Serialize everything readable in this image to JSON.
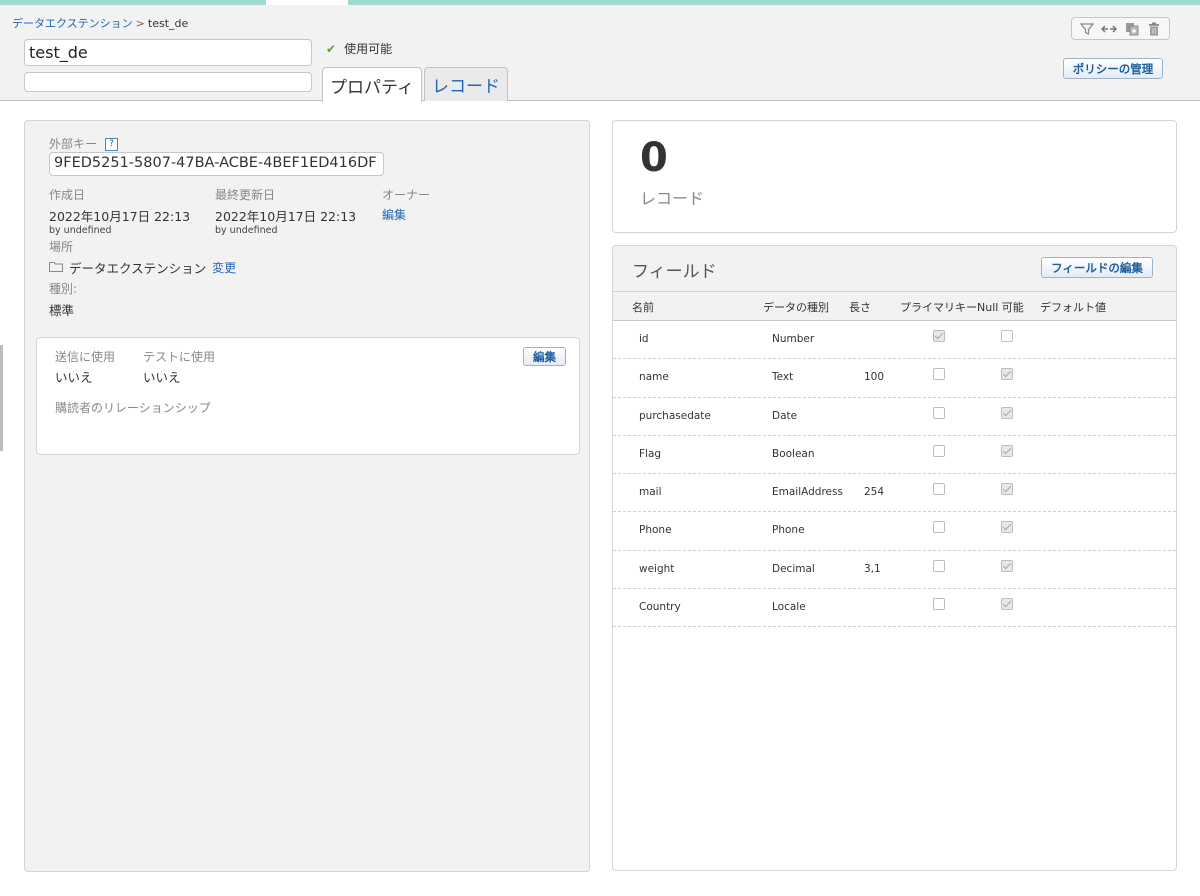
{
  "breadcrumb": {
    "parent": "データエクステンション",
    "separator": ">",
    "current": "test_de"
  },
  "header": {
    "name_value": "test_de",
    "description_value": "",
    "status_label": "使用可能",
    "tabs": [
      {
        "label": "プロパティ"
      },
      {
        "label": "レコード"
      }
    ],
    "policy_button": "ポリシーの管理",
    "toolbar_icons": [
      "filter-icon",
      "swap-icon",
      "copy-icon",
      "trash-icon"
    ]
  },
  "properties": {
    "external_key_label": "外部キー",
    "help_label": "?",
    "external_key_value": "9FED5251-5807-47BA-ACBE-4BEF1ED416DF",
    "created_label": "作成日",
    "created_value": "2022年10月17日 22:13",
    "created_by": "by undefined",
    "modified_label": "最終更新日",
    "modified_value": "2022年10月17日 22:13",
    "modified_by": "by undefined",
    "owner_label": "オーナー",
    "owner_edit": "編集",
    "location_label": "場所",
    "location_value": "データエクステンション",
    "location_change": "変更",
    "type_label": "種別:",
    "type_value": "標準"
  },
  "sendable": {
    "send_label": "送信に使用",
    "send_value": "いいえ",
    "test_label": "テストに使用",
    "test_value": "いいえ",
    "edit_button": "編集",
    "relationship_label": "購読者のリレーションシップ"
  },
  "records": {
    "count": "0",
    "label": "レコード"
  },
  "fields": {
    "title": "フィールド",
    "edit_button": "フィールドの編集",
    "columns": [
      "名前",
      "データの種別",
      "長さ",
      "プライマリキー",
      "Null 可能",
      "デフォルト値"
    ],
    "rows": [
      {
        "name": "id",
        "type": "Number",
        "length": "",
        "primary": true,
        "nullable": false,
        "default": ""
      },
      {
        "name": "name",
        "type": "Text",
        "length": "100",
        "primary": false,
        "nullable": true,
        "default": ""
      },
      {
        "name": "purchasedate",
        "type": "Date",
        "length": "",
        "primary": false,
        "nullable": true,
        "default": ""
      },
      {
        "name": "Flag",
        "type": "Boolean",
        "length": "",
        "primary": false,
        "nullable": true,
        "default": ""
      },
      {
        "name": "mail",
        "type": "EmailAddress",
        "length": "254",
        "primary": false,
        "nullable": true,
        "default": ""
      },
      {
        "name": "Phone",
        "type": "Phone",
        "length": "",
        "primary": false,
        "nullable": true,
        "default": ""
      },
      {
        "name": "weight",
        "type": "Decimal",
        "length": "3,1",
        "primary": false,
        "nullable": true,
        "default": ""
      },
      {
        "name": "Country",
        "type": "Locale",
        "length": "",
        "primary": false,
        "nullable": true,
        "default": ""
      }
    ]
  }
}
